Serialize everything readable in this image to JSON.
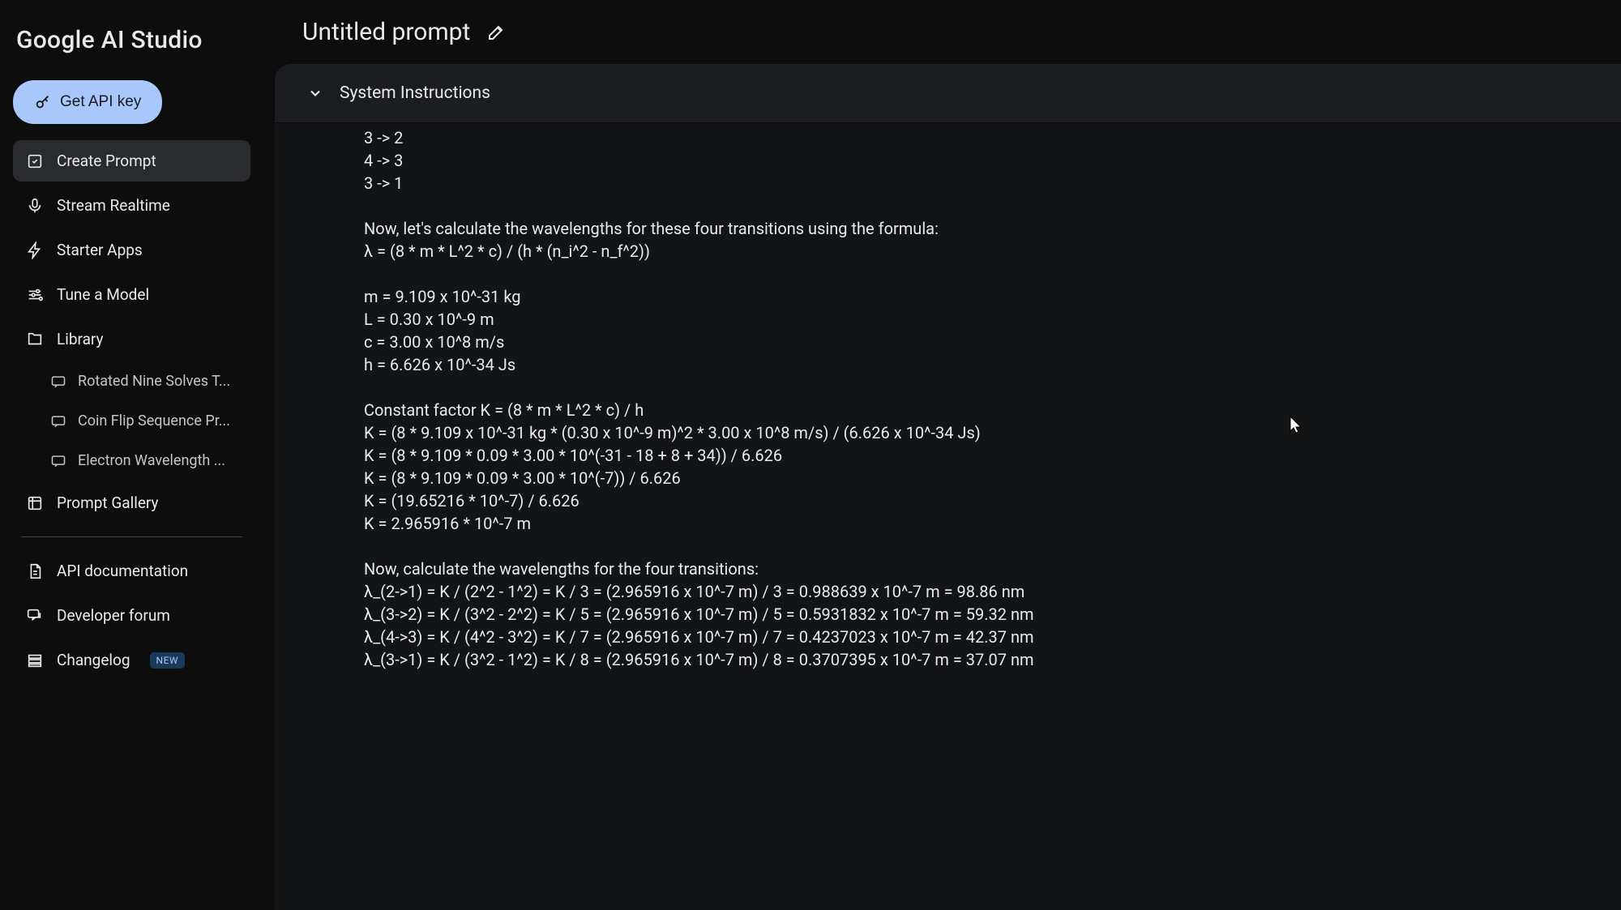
{
  "app_name": "Google AI Studio",
  "header": {
    "title": "Untitled prompt"
  },
  "sidebar": {
    "api_key_label": "Get API key",
    "nav": {
      "create_prompt": "Create Prompt",
      "stream_realtime": "Stream Realtime",
      "starter_apps": "Starter Apps",
      "tune_model": "Tune a Model",
      "library": "Library",
      "prompt_gallery": "Prompt Gallery"
    },
    "library_items": [
      "Rotated Nine Solves T...",
      "Coin Flip Sequence Pr...",
      "Electron Wavelength ..."
    ],
    "footer": {
      "api_docs": "API documentation",
      "dev_forum": "Developer forum",
      "changelog": "Changelog",
      "changelog_badge": "NEW"
    }
  },
  "system_instructions": {
    "label": "System Instructions"
  },
  "output_text": "3 -> 2\n4 -> 3\n3 -> 1\n\nNow, let's calculate the wavelengths for these four transitions using the formula:\nλ = (8 * m * L^2 * c) / (h * (n_i^2 - n_f^2))\n\nm = 9.109 x 10^-31 kg\nL = 0.30 x 10^-9 m\nc = 3.00 x 10^8 m/s\nh = 6.626 x 10^-34 Js\n\nConstant factor K = (8 * m * L^2 * c) / h\nK = (8 * 9.109 x 10^-31 kg * (0.30 x 10^-9 m)^2 * 3.00 x 10^8 m/s) / (6.626 x 10^-34 Js)\nK = (8 * 9.109 * 0.09 * 3.00 * 10^(-31 - 18 + 8 + 34)) / 6.626\nK = (8 * 9.109 * 0.09 * 3.00 * 10^(-7)) / 6.626\nK = (19.65216 * 10^-7) / 6.626\nK = 2.965916 * 10^-7 m\n\nNow, calculate the wavelengths for the four transitions:\nλ_(2->1) = K / (2^2 - 1^2) = K / 3 = (2.965916 x 10^-7 m) / 3 = 0.988639 x 10^-7 m = 98.86 nm\nλ_(3->2) = K / (3^2 - 2^2) = K / 5 = (2.965916 x 10^-7 m) / 5 = 0.5931832 x 10^-7 m = 59.32 nm\nλ_(4->3) = K / (4^2 - 3^2) = K / 7 = (2.965916 x 10^-7 m) / 7 = 0.4237023 x 10^-7 m = 42.37 nm\nλ_(3->1) = K / (3^2 - 1^2) = K / 8 = (2.965916 x 10^-7 m) / 8 = 0.3707395 x 10^-7 m = 37.07 nm"
}
